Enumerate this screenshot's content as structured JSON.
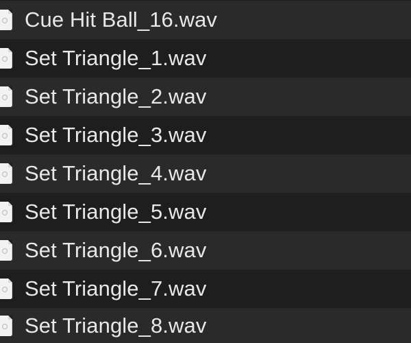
{
  "file_list": {
    "items": [
      {
        "name": "Cue Hit Ball_16.wav",
        "icon": "audio-file-icon"
      },
      {
        "name": "Set Triangle_1.wav",
        "icon": "audio-file-icon"
      },
      {
        "name": "Set Triangle_2.wav",
        "icon": "audio-file-icon"
      },
      {
        "name": "Set Triangle_3.wav",
        "icon": "audio-file-icon"
      },
      {
        "name": "Set Triangle_4.wav",
        "icon": "audio-file-icon"
      },
      {
        "name": "Set Triangle_5.wav",
        "icon": "audio-file-icon"
      },
      {
        "name": "Set Triangle_6.wav",
        "icon": "audio-file-icon"
      },
      {
        "name": "Set Triangle_7.wav",
        "icon": "audio-file-icon"
      },
      {
        "name": "Set Triangle_8.wav",
        "icon": "audio-file-icon"
      }
    ]
  },
  "colors": {
    "row_dark": "#1e1e1e",
    "row_light": "#2a2a2a",
    "text": "#e8e8e8"
  }
}
